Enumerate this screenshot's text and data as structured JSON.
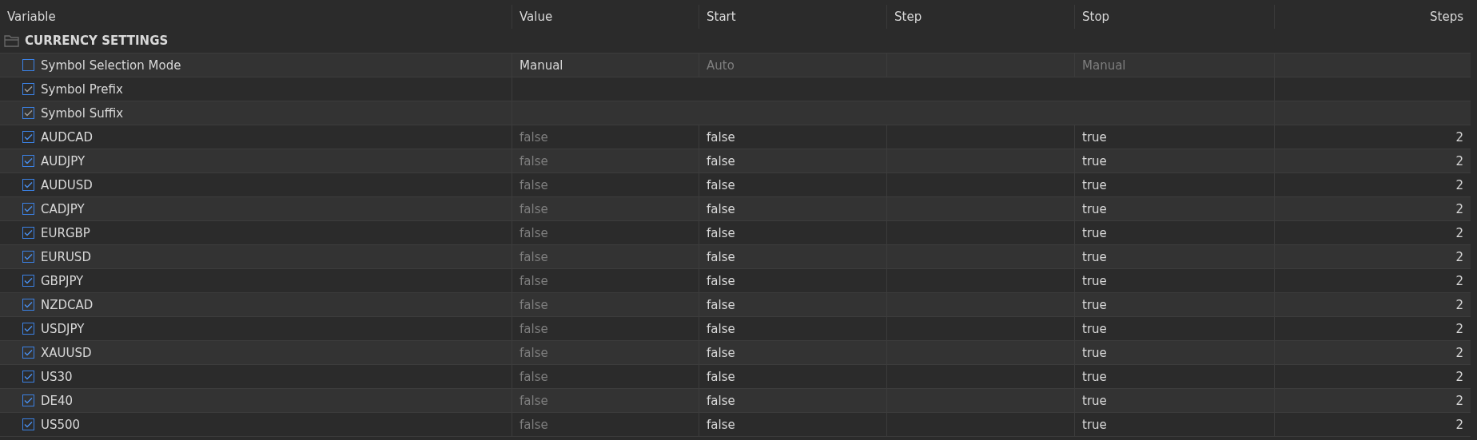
{
  "columns": [
    "Variable",
    "Value",
    "Start",
    "Step",
    "Stop",
    "Steps"
  ],
  "group": {
    "label": "CURRENCY SETTINGS",
    "expanded": true
  },
  "rows": [
    {
      "kind": "enum",
      "name": "Symbol Selection Mode",
      "checked": false,
      "value": {
        "text": "Manual",
        "dim": false
      },
      "start": {
        "text": "Auto",
        "dim": true
      },
      "stop": {
        "text": "Manual",
        "dim": true
      }
    },
    {
      "kind": "string",
      "name": "Symbol Prefix",
      "checked": true
    },
    {
      "kind": "string",
      "name": "Symbol Suffix",
      "checked": true
    },
    {
      "kind": "bool",
      "name": "AUDCAD",
      "checked": true,
      "value": {
        "text": "false",
        "dim": true
      },
      "start": {
        "text": "false",
        "dim": false
      },
      "stop": {
        "text": "true",
        "dim": false
      },
      "steps": "2"
    },
    {
      "kind": "bool",
      "name": "AUDJPY",
      "checked": true,
      "value": {
        "text": "false",
        "dim": true
      },
      "start": {
        "text": "false",
        "dim": false
      },
      "stop": {
        "text": "true",
        "dim": false
      },
      "steps": "2"
    },
    {
      "kind": "bool",
      "name": "AUDUSD",
      "checked": true,
      "value": {
        "text": "false",
        "dim": true
      },
      "start": {
        "text": "false",
        "dim": false
      },
      "stop": {
        "text": "true",
        "dim": false
      },
      "steps": "2"
    },
    {
      "kind": "bool",
      "name": "CADJPY",
      "checked": true,
      "value": {
        "text": "false",
        "dim": true
      },
      "start": {
        "text": "false",
        "dim": false
      },
      "stop": {
        "text": "true",
        "dim": false
      },
      "steps": "2"
    },
    {
      "kind": "bool",
      "name": "EURGBP",
      "checked": true,
      "value": {
        "text": "false",
        "dim": true
      },
      "start": {
        "text": "false",
        "dim": false
      },
      "stop": {
        "text": "true",
        "dim": false
      },
      "steps": "2"
    },
    {
      "kind": "bool",
      "name": "EURUSD",
      "checked": true,
      "value": {
        "text": "false",
        "dim": true
      },
      "start": {
        "text": "false",
        "dim": false
      },
      "stop": {
        "text": "true",
        "dim": false
      },
      "steps": "2"
    },
    {
      "kind": "bool",
      "name": "GBPJPY",
      "checked": true,
      "value": {
        "text": "false",
        "dim": true
      },
      "start": {
        "text": "false",
        "dim": false
      },
      "stop": {
        "text": "true",
        "dim": false
      },
      "steps": "2"
    },
    {
      "kind": "bool",
      "name": "NZDCAD",
      "checked": true,
      "value": {
        "text": "false",
        "dim": true
      },
      "start": {
        "text": "false",
        "dim": false
      },
      "stop": {
        "text": "true",
        "dim": false
      },
      "steps": "2"
    },
    {
      "kind": "bool",
      "name": "USDJPY",
      "checked": true,
      "value": {
        "text": "false",
        "dim": true
      },
      "start": {
        "text": "false",
        "dim": false
      },
      "stop": {
        "text": "true",
        "dim": false
      },
      "steps": "2"
    },
    {
      "kind": "bool",
      "name": "XAUUSD",
      "checked": true,
      "value": {
        "text": "false",
        "dim": true
      },
      "start": {
        "text": "false",
        "dim": false
      },
      "stop": {
        "text": "true",
        "dim": false
      },
      "steps": "2"
    },
    {
      "kind": "bool",
      "name": "US30",
      "checked": true,
      "value": {
        "text": "false",
        "dim": true
      },
      "start": {
        "text": "false",
        "dim": false
      },
      "stop": {
        "text": "true",
        "dim": false
      },
      "steps": "2"
    },
    {
      "kind": "bool",
      "name": "DE40",
      "checked": true,
      "value": {
        "text": "false",
        "dim": true
      },
      "start": {
        "text": "false",
        "dim": false
      },
      "stop": {
        "text": "true",
        "dim": false
      },
      "steps": "2"
    },
    {
      "kind": "bool",
      "name": "US500",
      "checked": true,
      "value": {
        "text": "false",
        "dim": true
      },
      "start": {
        "text": "false",
        "dim": false
      },
      "stop": {
        "text": "true",
        "dim": false
      },
      "steps": "2"
    }
  ]
}
